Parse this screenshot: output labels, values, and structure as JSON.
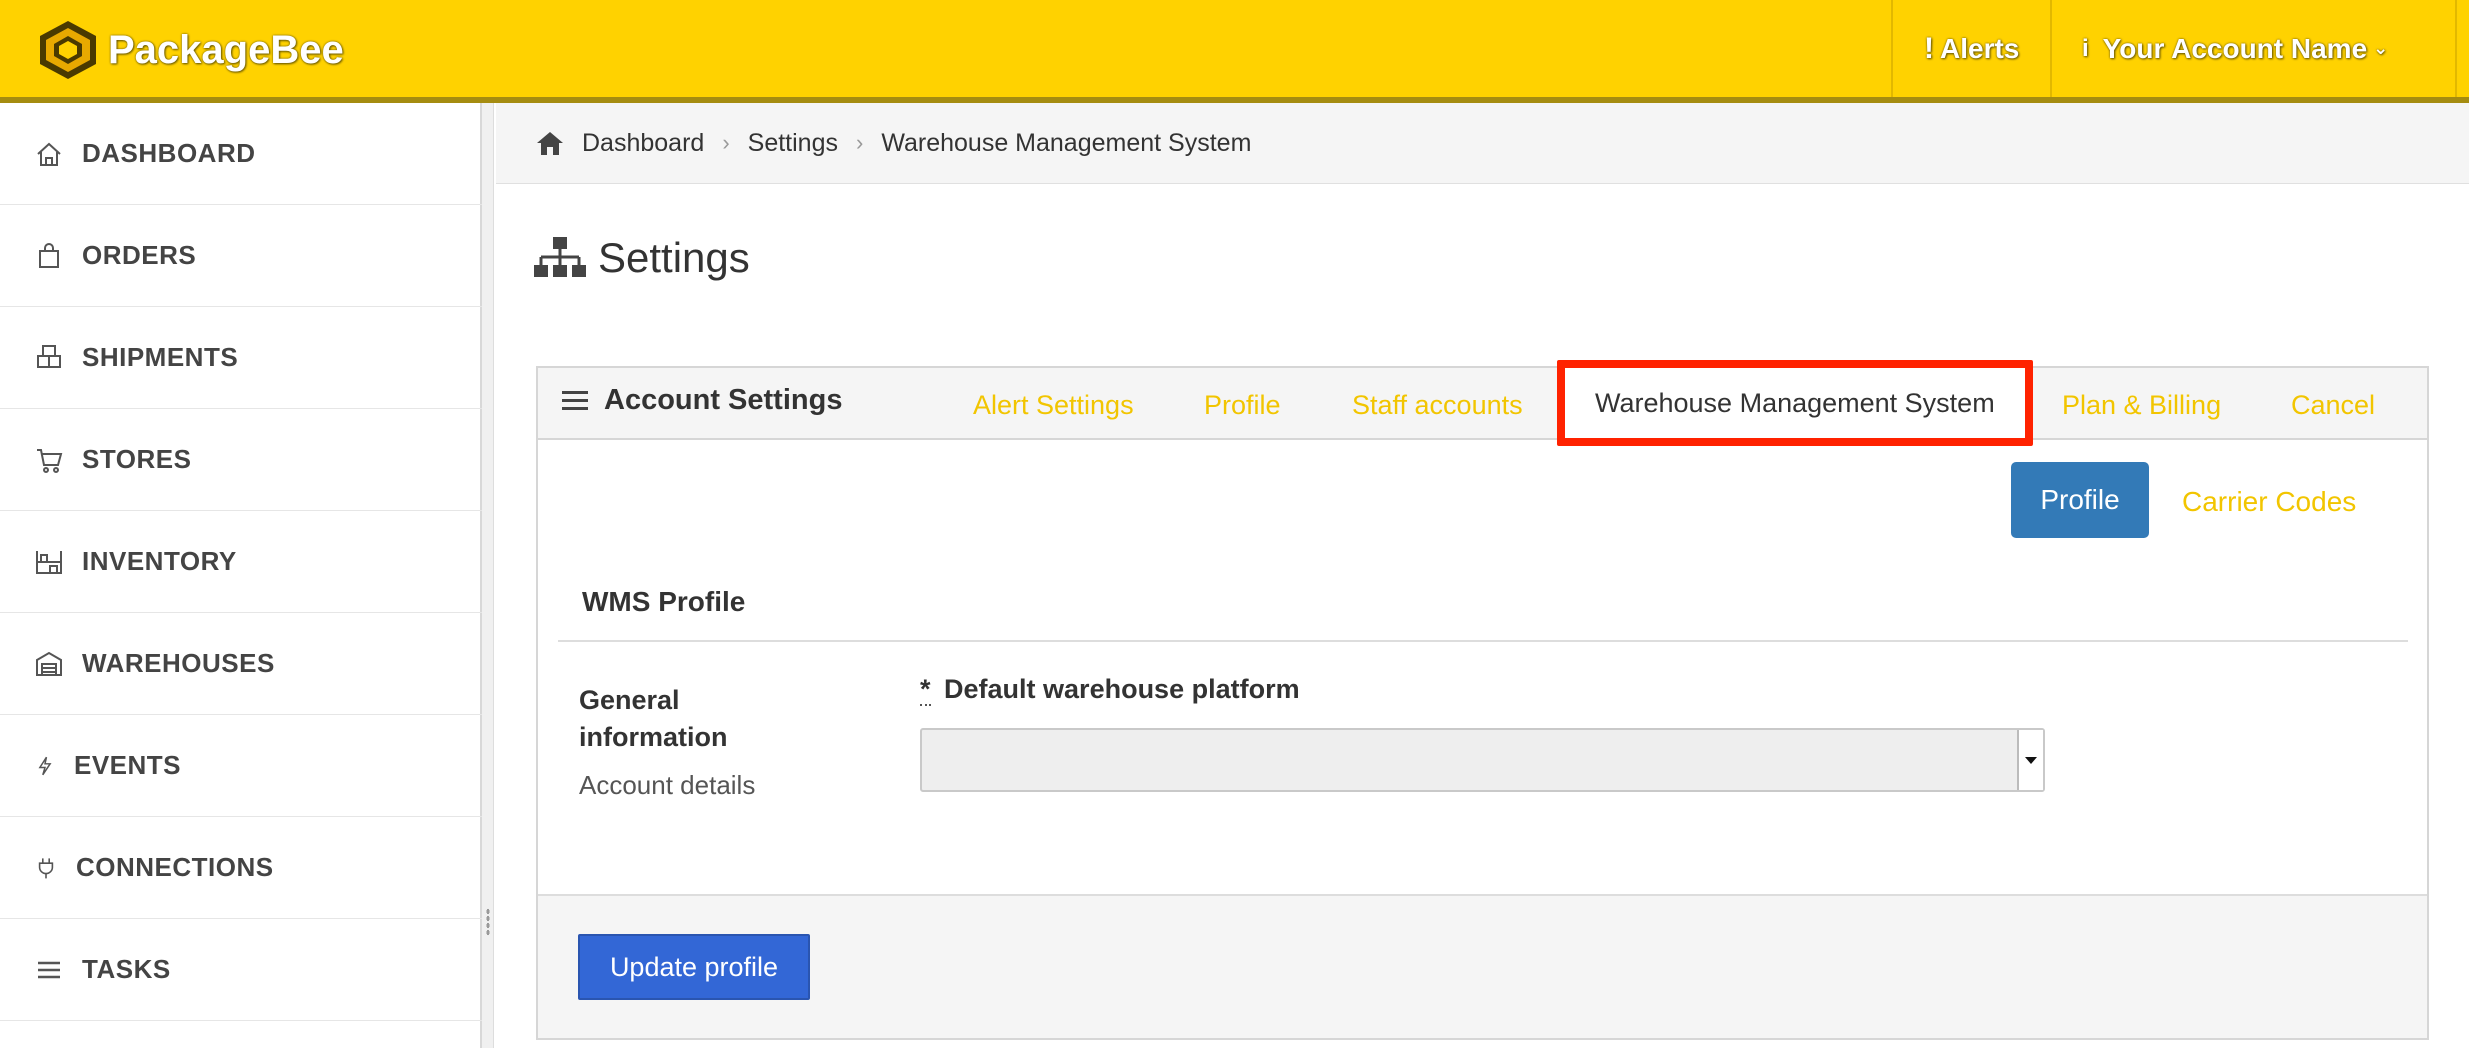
{
  "app": {
    "brand": "PackageBee",
    "brand_color": "#ffd200"
  },
  "topbar": {
    "alerts_label": "Alerts",
    "account_label": "Your Account Name"
  },
  "sidebar": {
    "items": [
      {
        "label": "DASHBOARD",
        "icon": "home-icon"
      },
      {
        "label": "ORDERS",
        "icon": "shopping-bag-icon"
      },
      {
        "label": "SHIPMENTS",
        "icon": "boxes-icon"
      },
      {
        "label": "STORES",
        "icon": "cart-icon"
      },
      {
        "label": "INVENTORY",
        "icon": "shelves-icon"
      },
      {
        "label": "WAREHOUSES",
        "icon": "warehouse-icon"
      },
      {
        "label": "EVENTS",
        "icon": "bolt-icon"
      },
      {
        "label": "CONNECTIONS",
        "icon": "plug-icon"
      },
      {
        "label": "TASKS",
        "icon": "list-icon"
      }
    ]
  },
  "breadcrumb": {
    "items": [
      "Dashboard",
      "Settings",
      "Warehouse Management System"
    ]
  },
  "page": {
    "title": "Settings"
  },
  "panel": {
    "title": "Account Settings",
    "tabs": [
      "Alert Settings",
      "Profile",
      "Staff accounts",
      "Warehouse Management System",
      "Plan & Billing",
      "Cancel"
    ],
    "active_tab": "Warehouse Management System",
    "subtabs": {
      "active": "Profile",
      "other": "Carrier Codes"
    },
    "section_title": "WMS Profile",
    "group_title": "General information",
    "group_subtitle": "Account details",
    "field": {
      "required_mark": "*",
      "label": "Default warehouse platform",
      "value": ""
    },
    "submit_label": "Update profile"
  },
  "colors": {
    "tab_link": "#f2c500",
    "highlight_box": "#ff2200",
    "primary_button": "#337ab7",
    "submit_button": "#3367d6"
  }
}
